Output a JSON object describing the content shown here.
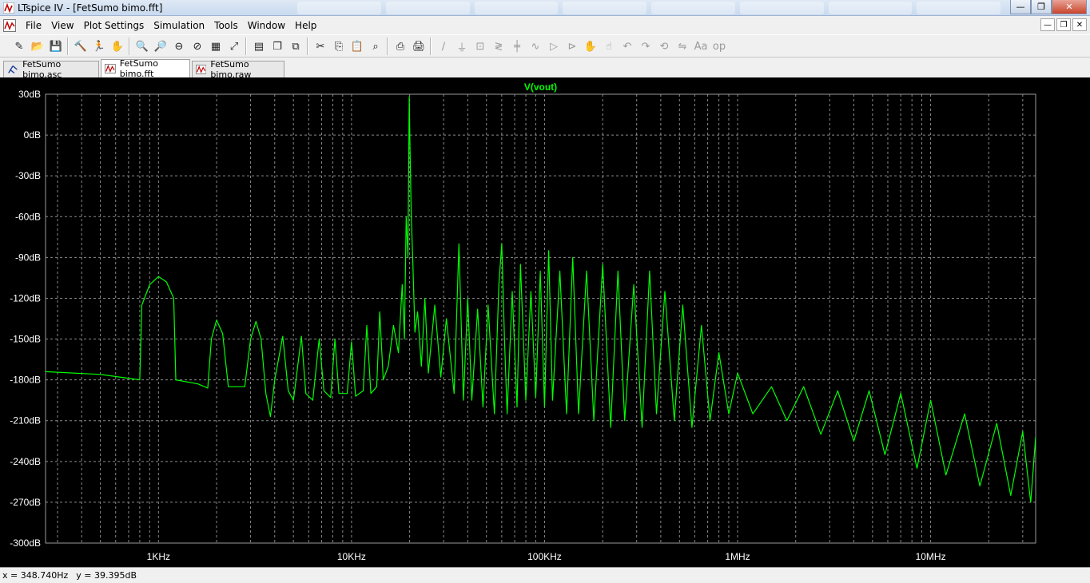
{
  "window": {
    "title": "LTspice IV - [FetSumo bimo.fft]",
    "minimize_glyph": "—",
    "restore_glyph": "❐",
    "close_glyph": "✕"
  },
  "menu": [
    "File",
    "View",
    "Plot Settings",
    "Simulation",
    "Tools",
    "Window",
    "Help"
  ],
  "toolbar_icons": [
    "new-schematic-icon",
    "open-icon",
    "save-icon",
    "control-panel-icon",
    "run-icon",
    "pan-icon",
    "zoom-in-icon",
    "zoom-out-icon",
    "zoom-full-icon",
    "zoom-cancel-icon",
    "autorange-icon",
    "zoom-fit-icon",
    "tile-horizontal-icon",
    "cascade-icon",
    "close-all-icon",
    "cut-icon",
    "copy-icon",
    "paste-icon",
    "find-icon",
    "print-setup-icon",
    "print-icon",
    "wire-icon",
    "ground-icon",
    "label-icon",
    "resistor-icon",
    "capacitor-icon",
    "inductor-icon",
    "diode-icon",
    "component-icon",
    "move-icon",
    "drag-icon",
    "undo-icon",
    "redo-icon",
    "rotate-icon",
    "mirror-icon",
    "text-icon",
    "spice-directive-icon"
  ],
  "doc_tabs": [
    {
      "label": "FetSumo bimo.asc",
      "icon": "schematic-icon",
      "active": false
    },
    {
      "label": "FetSumo bimo.fft",
      "icon": "waveform-icon",
      "active": true
    },
    {
      "label": "FetSumo bimo.raw",
      "icon": "waveform-icon",
      "active": false
    }
  ],
  "status": {
    "x_readout": "x = 348.740Hz",
    "y_readout": "y = 39.395dB"
  },
  "colors": {
    "trace": "#00ff00",
    "plot_bg": "#000000",
    "grid": "#8a8a8a",
    "axis_text": "#ffffff"
  },
  "chart_data": {
    "type": "line",
    "title": "V(vout)",
    "x_scale": "log",
    "xlim": [
      260,
      35000000
    ],
    "ylim": [
      -300,
      30
    ],
    "x_ticks": [
      {
        "value": 1000,
        "label": "1KHz"
      },
      {
        "value": 10000,
        "label": "10KHz"
      },
      {
        "value": 100000,
        "label": "100KHz"
      },
      {
        "value": 1000000,
        "label": "1MHz"
      },
      {
        "value": 10000000,
        "label": "10MHz"
      }
    ],
    "y_ticks": [
      {
        "value": 30,
        "label": "30dB"
      },
      {
        "value": 0,
        "label": "0dB"
      },
      {
        "value": -30,
        "label": "-30dB"
      },
      {
        "value": -60,
        "label": "-60dB"
      },
      {
        "value": -90,
        "label": "-90dB"
      },
      {
        "value": -120,
        "label": "-120dB"
      },
      {
        "value": -150,
        "label": "-150dB"
      },
      {
        "value": -180,
        "label": "-180dB"
      },
      {
        "value": -210,
        "label": "-210dB"
      },
      {
        "value": -240,
        "label": "-240dB"
      },
      {
        "value": -270,
        "label": "-270dB"
      },
      {
        "value": -300,
        "label": "-300dB"
      }
    ],
    "grid": true,
    "grid_style": "dashed",
    "series": [
      {
        "color": "#00ff00",
        "points": [
          [
            260,
            -174
          ],
          [
            500,
            -176
          ],
          [
            800,
            -180
          ],
          [
            820,
            -125
          ],
          [
            900,
            -110
          ],
          [
            1000,
            -104
          ],
          [
            1100,
            -108
          ],
          [
            1200,
            -120
          ],
          [
            1230,
            -180
          ],
          [
            1600,
            -183
          ],
          [
            1800,
            -186
          ],
          [
            1880,
            -150
          ],
          [
            2000,
            -136
          ],
          [
            2150,
            -146
          ],
          [
            2300,
            -185
          ],
          [
            2800,
            -185
          ],
          [
            3000,
            -150
          ],
          [
            3200,
            -137
          ],
          [
            3400,
            -150
          ],
          [
            3600,
            -190
          ],
          [
            3800,
            -207
          ],
          [
            4000,
            -180
          ],
          [
            4400,
            -148
          ],
          [
            4700,
            -188
          ],
          [
            5000,
            -195
          ],
          [
            5500,
            -148
          ],
          [
            5800,
            -190
          ],
          [
            6300,
            -195
          ],
          [
            6800,
            -150
          ],
          [
            7200,
            -188
          ],
          [
            7800,
            -193
          ],
          [
            8200,
            -150
          ],
          [
            8600,
            -190
          ],
          [
            9500,
            -190
          ],
          [
            10000,
            -152
          ],
          [
            10500,
            -192
          ],
          [
            11500,
            -188
          ],
          [
            12000,
            -140
          ],
          [
            12600,
            -190
          ],
          [
            13500,
            -185
          ],
          [
            14000,
            -130
          ],
          [
            14600,
            -180
          ],
          [
            15500,
            -170
          ],
          [
            16500,
            -140
          ],
          [
            17500,
            -160
          ],
          [
            18300,
            -110
          ],
          [
            18800,
            -150
          ],
          [
            19200,
            -60
          ],
          [
            19600,
            -90
          ],
          [
            19900,
            28
          ],
          [
            20100,
            -10
          ],
          [
            20400,
            -60
          ],
          [
            20800,
            -95
          ],
          [
            21300,
            -145
          ],
          [
            22000,
            -130
          ],
          [
            23000,
            -170
          ],
          [
            24000,
            -120
          ],
          [
            25000,
            -175
          ],
          [
            27000,
            -125
          ],
          [
            29000,
            -178
          ],
          [
            31000,
            -135
          ],
          [
            34000,
            -190
          ],
          [
            36000,
            -80
          ],
          [
            38000,
            -195
          ],
          [
            40000,
            -120
          ],
          [
            42000,
            -195
          ],
          [
            45000,
            -128
          ],
          [
            48000,
            -200
          ],
          [
            51000,
            -125
          ],
          [
            55000,
            -205
          ],
          [
            58000,
            -110
          ],
          [
            60000,
            -80
          ],
          [
            62000,
            -150
          ],
          [
            64000,
            -205
          ],
          [
            68000,
            -115
          ],
          [
            72000,
            -200
          ],
          [
            75000,
            -95
          ],
          [
            80000,
            -195
          ],
          [
            85000,
            -115
          ],
          [
            90000,
            -193
          ],
          [
            95000,
            -100
          ],
          [
            100000,
            -200
          ],
          [
            105000,
            -85
          ],
          [
            110000,
            -195
          ],
          [
            120000,
            -100
          ],
          [
            130000,
            -205
          ],
          [
            140000,
            -90
          ],
          [
            150000,
            -205
          ],
          [
            165000,
            -100
          ],
          [
            180000,
            -210
          ],
          [
            200000,
            -95
          ],
          [
            220000,
            -215
          ],
          [
            240000,
            -100
          ],
          [
            260000,
            -210
          ],
          [
            290000,
            -110
          ],
          [
            320000,
            -215
          ],
          [
            350000,
            -100
          ],
          [
            380000,
            -205
          ],
          [
            420000,
            -115
          ],
          [
            470000,
            -210
          ],
          [
            520000,
            -125
          ],
          [
            580000,
            -215
          ],
          [
            650000,
            -140
          ],
          [
            720000,
            -210
          ],
          [
            800000,
            -160
          ],
          [
            900000,
            -205
          ],
          [
            1000000,
            -175
          ],
          [
            1200000,
            -205
          ],
          [
            1500000,
            -185
          ],
          [
            1800000,
            -210
          ],
          [
            2200000,
            -185
          ],
          [
            2700000,
            -220
          ],
          [
            3300000,
            -188
          ],
          [
            4000000,
            -225
          ],
          [
            4800000,
            -188
          ],
          [
            5800000,
            -235
          ],
          [
            7000000,
            -190
          ],
          [
            8500000,
            -245
          ],
          [
            10000000,
            -195
          ],
          [
            12000000,
            -250
          ],
          [
            15000000,
            -205
          ],
          [
            18000000,
            -258
          ],
          [
            22000000,
            -212
          ],
          [
            26000000,
            -265
          ],
          [
            30000000,
            -218
          ],
          [
            33000000,
            -270
          ],
          [
            35000000,
            -222
          ]
        ]
      }
    ]
  }
}
